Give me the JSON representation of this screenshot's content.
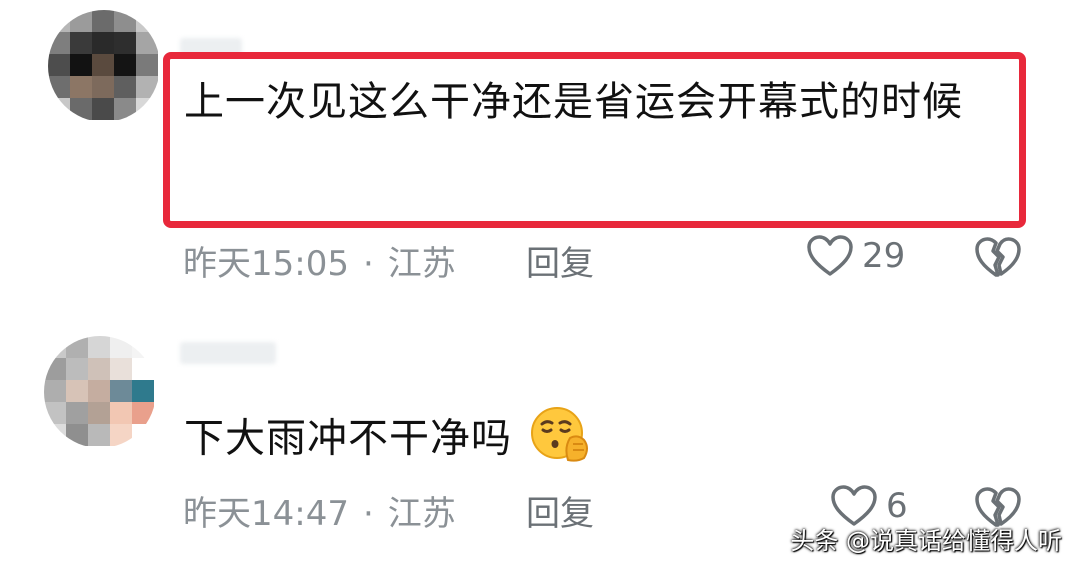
{
  "comments": [
    {
      "text": "上一次见这么干净还是省运会开幕式的时候",
      "timestamp": "昨天15:05",
      "location": "江苏",
      "reply_label": "回复",
      "likes": "29",
      "highlighted": true,
      "avatar_icon": "pixelated-avatar"
    },
    {
      "text": "下大雨冲不干净吗",
      "timestamp": "昨天14:47",
      "location": "江苏",
      "reply_label": "回复",
      "likes": "6",
      "highlighted": false,
      "emoji": "face-with-hand-over-mouth",
      "avatar_icon": "pixelated-avatar"
    }
  ],
  "separator": "·",
  "watermark": "头条 @说真话给懂得人听",
  "colors": {
    "highlight_border": "#e8283b",
    "meta_text": "#8b9196",
    "comment_text": "#111111"
  },
  "icons": {
    "like": "heart-outline-icon",
    "dislike": "broken-heart-icon"
  }
}
